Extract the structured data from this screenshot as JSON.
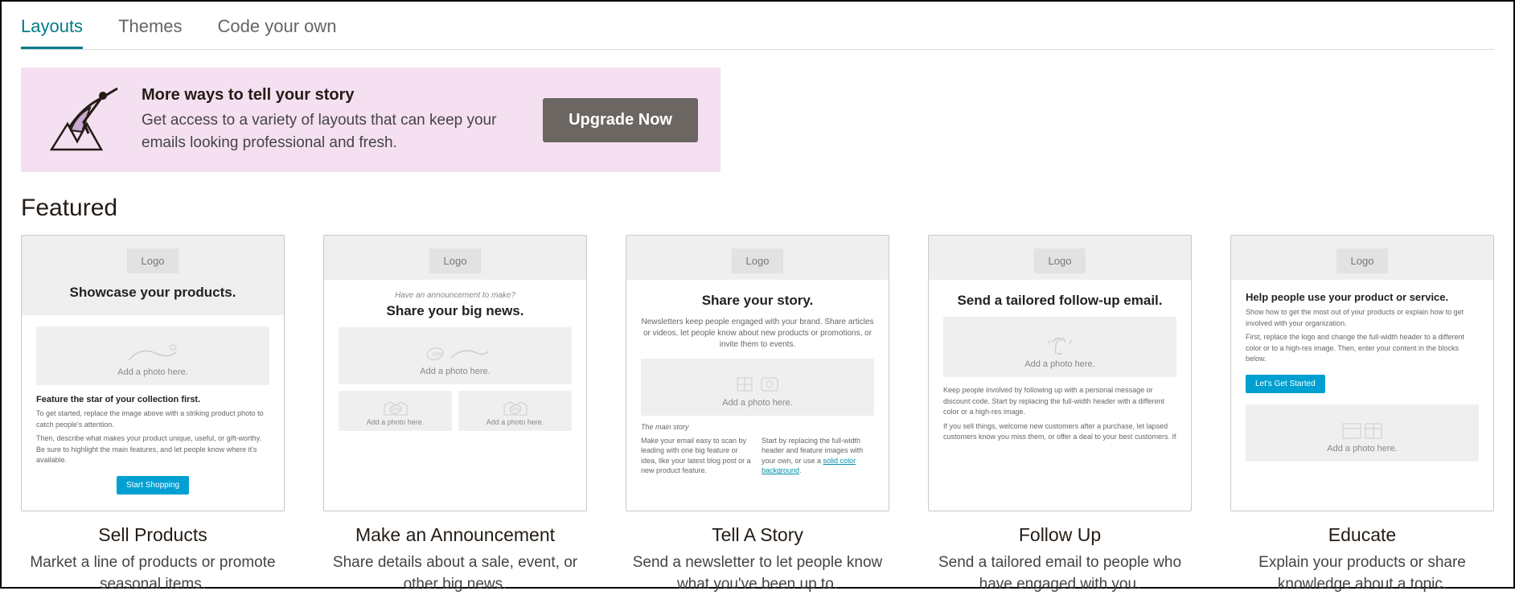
{
  "tabs": {
    "layouts": "Layouts",
    "themes": "Themes",
    "code": "Code your own"
  },
  "banner": {
    "title": "More ways to tell your story",
    "body": "Get access to a variety of layouts that can keep your emails looking professional and fresh.",
    "button": "Upgrade Now"
  },
  "section": "Featured",
  "logo_label": "Logo",
  "photo_label": "Add a photo here.",
  "cards": [
    {
      "title": "Sell Products",
      "desc": "Market a line of products or promote seasonal items.",
      "thumb": {
        "headline": "Showcase your products.",
        "sub_bold": "Feature the star of your collection first.",
        "p1": "To get started, replace the image above with a striking product photo to catch people's attention.",
        "p2": "Then, describe what makes your product unique, useful, or gift-worthy. Be sure to highlight the main features, and let people know where it's available.",
        "btn": "Start Shopping"
      }
    },
    {
      "title": "Make an Announcement",
      "desc": "Share details about a sale, event, or other big news.",
      "thumb": {
        "eyebrow": "Have an announcement to make?",
        "headline": "Share your big news."
      }
    },
    {
      "title": "Tell A Story",
      "desc": "Send a newsletter to let people know what you've been up to.",
      "thumb": {
        "headline": "Share your story.",
        "sub": "Newsletters keep people engaged with your brand. Share articles or videos, let people know about new products or promotions, or invite them to events.",
        "col_head": "The main story",
        "col1": "Make your email easy to scan by leading with one big feature or idea, like your latest blog post or a new product feature.",
        "col2_a": "Start by replacing the full-width header and feature images with your own, or use a ",
        "col2_link": "solid color background",
        "col2_b": "."
      }
    },
    {
      "title": "Follow Up",
      "desc": "Send a tailored email to people who have engaged with you.",
      "thumb": {
        "headline": "Send a tailored follow-up email.",
        "p1": "Keep people involved by following up with a personal message or discount code. Start by replacing the full-width header with a different color or a high-res image.",
        "p2": "If you sell things, welcome new customers after a purchase, let lapsed customers know you miss them, or offer a deal to your best customers. If"
      }
    },
    {
      "title": "Educate",
      "desc": "Explain your products or share knowledge about a topic.",
      "thumb": {
        "headline": "Help people use your product or service.",
        "p1": "Show how to get the most out of your products or explain how to get involved with your organization.",
        "p2": "First, replace the logo and change the full-width header to a different color or to a high-res image. Then, enter your content in the blocks below.",
        "btn": "Let's Get Started"
      }
    }
  ]
}
